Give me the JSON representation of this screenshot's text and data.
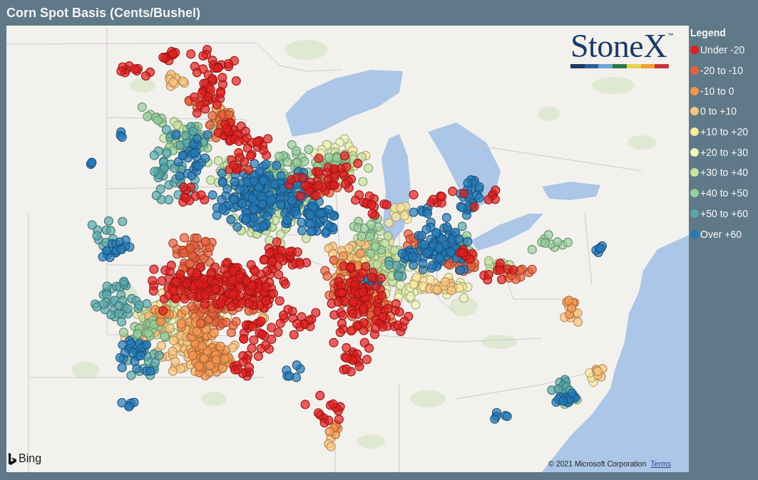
{
  "title": "Corn Spot Basis (Cents/Bushel)",
  "map": {
    "logo": {
      "text": "StoneX",
      "mark": "™"
    },
    "attribution": {
      "provider": "Bing",
      "copyright": "© 2021 Microsoft Corporation",
      "link": "Terms"
    }
  },
  "legend": {
    "title": "Legend",
    "items": [
      {
        "label": "Under -20",
        "color": "#e0201f"
      },
      {
        "label": "-20 to -10",
        "color": "#e8603a"
      },
      {
        "label": "-10 to 0",
        "color": "#f4954e"
      },
      {
        "label": "0 to +10",
        "color": "#fbc57d"
      },
      {
        "label": "+10 to +20",
        "color": "#fde9a0"
      },
      {
        "label": "+20 to +30",
        "color": "#eef7b9"
      },
      {
        "label": "+30 to +40",
        "color": "#c7e4a1"
      },
      {
        "label": "+40 to +50",
        "color": "#95cf9a"
      },
      {
        "label": "+50 to +60",
        "color": "#58a8aa"
      },
      {
        "label": "Over +60",
        "color": "#2479b7"
      }
    ]
  }
}
